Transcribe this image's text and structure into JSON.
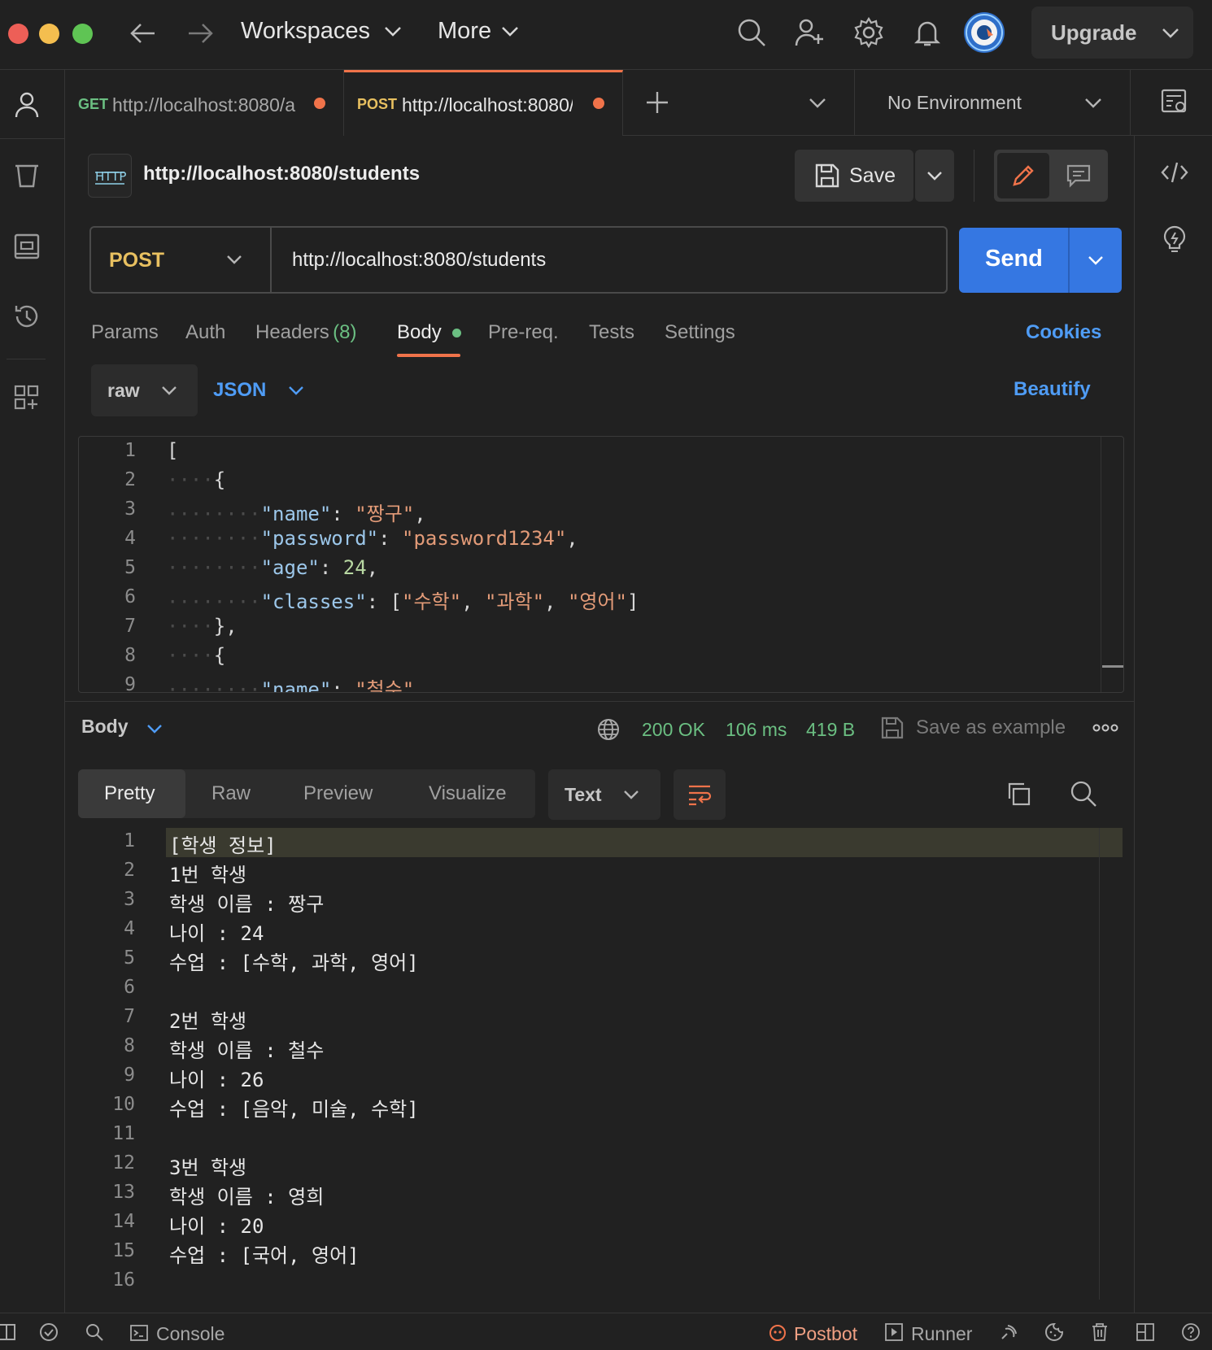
{
  "titlebar": {
    "workspaces": "Workspaces",
    "more": "More",
    "upgrade": "Upgrade"
  },
  "tabs": [
    {
      "method": "GET",
      "url": "http://localhost:8080/a",
      "method_color": "#6bbf82"
    },
    {
      "method": "POST",
      "url": "http://localhost:8080/",
      "method_color": "#e8c060"
    }
  ],
  "environment": "No Environment",
  "request": {
    "name": "http://localhost:8080/students",
    "save_label": "Save",
    "method": "POST",
    "url": "http://localhost:8080/students",
    "send_label": "Send"
  },
  "request_tabs": {
    "params": "Params",
    "auth": "Auth",
    "headers": "Headers",
    "headers_count": "(8)",
    "body": "Body",
    "prereq": "Pre-req.",
    "tests": "Tests",
    "settings": "Settings",
    "cookies": "Cookies"
  },
  "body_options": {
    "mode": "raw",
    "language": "JSON",
    "beautify": "Beautify"
  },
  "editor_lines": [
    {
      "n": "1",
      "ind": "",
      "seg": [
        [
          "p",
          "["
        ]
      ]
    },
    {
      "n": "2",
      "ind": "····",
      "seg": [
        [
          "p",
          "{"
        ]
      ]
    },
    {
      "n": "3",
      "ind": "········",
      "seg": [
        [
          "k",
          "\"name\""
        ],
        [
          "p",
          ": "
        ],
        [
          "s",
          "\"짱구\""
        ],
        [
          "p",
          ","
        ]
      ]
    },
    {
      "n": "4",
      "ind": "········",
      "seg": [
        [
          "k",
          "\"password\""
        ],
        [
          "p",
          ": "
        ],
        [
          "s",
          "\"password1234\""
        ],
        [
          "p",
          ","
        ]
      ]
    },
    {
      "n": "5",
      "ind": "········",
      "seg": [
        [
          "k",
          "\"age\""
        ],
        [
          "p",
          ": "
        ],
        [
          "d",
          "24"
        ],
        [
          "p",
          ","
        ]
      ]
    },
    {
      "n": "6",
      "ind": "········",
      "seg": [
        [
          "k",
          "\"classes\""
        ],
        [
          "p",
          ": ["
        ],
        [
          "s",
          "\"수학\""
        ],
        [
          "p",
          ", "
        ],
        [
          "s",
          "\"과학\""
        ],
        [
          "p",
          ", "
        ],
        [
          "s",
          "\"영어\""
        ],
        [
          "p",
          "]"
        ]
      ]
    },
    {
      "n": "7",
      "ind": "····",
      "seg": [
        [
          "p",
          "},"
        ]
      ]
    },
    {
      "n": "8",
      "ind": "····",
      "seg": [
        [
          "p",
          "{"
        ]
      ]
    },
    {
      "n": "9",
      "ind": "········",
      "seg": [
        [
          "k",
          "\"name\""
        ],
        [
          "p",
          ": "
        ],
        [
          "s",
          "\"철수\""
        ],
        [
          "p",
          ","
        ]
      ]
    }
  ],
  "response": {
    "body_label": "Body",
    "status": "200 OK",
    "time": "106 ms",
    "size": "419 B",
    "save_example": "Save as example",
    "view_tabs": [
      "Pretty",
      "Raw",
      "Preview",
      "Visualize"
    ],
    "format": "Text",
    "lines": [
      {
        "n": "1",
        "t": "[학생 정보]"
      },
      {
        "n": "2",
        "t": "1번 학생"
      },
      {
        "n": "3",
        "t": "학생 이름 : 짱구"
      },
      {
        "n": "4",
        "t": "나이 : 24"
      },
      {
        "n": "5",
        "t": "수업 : [수학, 과학, 영어]"
      },
      {
        "n": "6",
        "t": ""
      },
      {
        "n": "7",
        "t": "2번 학생"
      },
      {
        "n": "8",
        "t": "학생 이름 : 철수"
      },
      {
        "n": "9",
        "t": "나이 : 26"
      },
      {
        "n": "10",
        "t": "수업 : [음악, 미술, 수학]"
      },
      {
        "n": "11",
        "t": ""
      },
      {
        "n": "12",
        "t": "3번 학생"
      },
      {
        "n": "13",
        "t": "학생 이름 : 영희"
      },
      {
        "n": "14",
        "t": "나이 : 20"
      },
      {
        "n": "15",
        "t": "수업 : [국어, 영어]"
      },
      {
        "n": "16",
        "t": ""
      }
    ]
  },
  "statusbar": {
    "console": "Console",
    "postbot": "Postbot",
    "runner": "Runner"
  },
  "colors": {
    "accent": "#f0734a",
    "send_blue": "#3577e2",
    "link_blue": "#4f9cf5",
    "success_green": "#6bbf82",
    "post_yellow": "#e8c060"
  }
}
